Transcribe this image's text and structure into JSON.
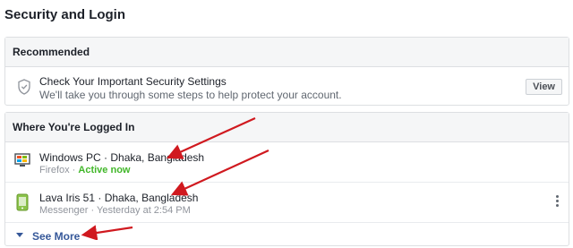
{
  "page": {
    "title": "Security and Login"
  },
  "recommended": {
    "header": "Recommended",
    "item": {
      "title": "Check Your Important Security Settings",
      "subtitle": "We'll take you through some steps to help protect your account.",
      "button_label": "View",
      "icon": "shield-icon"
    }
  },
  "logged_in": {
    "header": "Where You're Logged In",
    "sessions": [
      {
        "device": "Windows PC",
        "location": "Dhaka, Bangladesh",
        "app": "Firefox",
        "status": "Active now",
        "icon": "desktop-icon"
      },
      {
        "device": "Lava Iris 51",
        "location": "Dhaka, Bangladesh",
        "app": "Messenger",
        "time": "Yesterday at 2:54 PM",
        "icon": "phone-icon"
      }
    ],
    "see_more": "See More"
  },
  "colors": {
    "link": "#365899",
    "active": "#42b72a",
    "annotation_arrow": "#d0191f"
  }
}
